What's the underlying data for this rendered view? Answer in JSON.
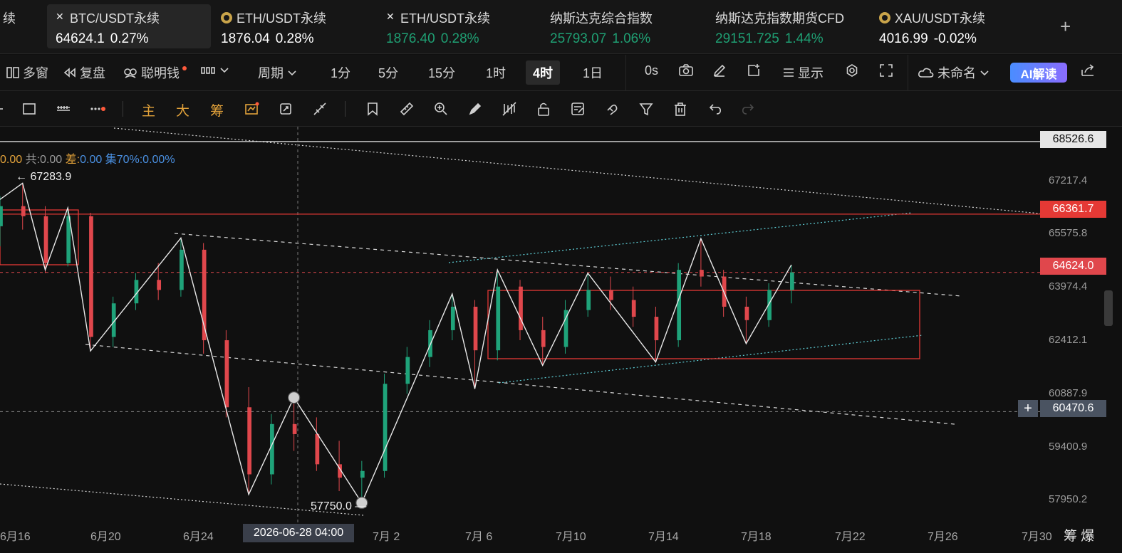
{
  "tickers": [
    {
      "name": "BTC/USDT永续",
      "price": "64624.1",
      "change": "0.27%",
      "icon": "pair-icon",
      "tone": "white",
      "active": true
    },
    {
      "name": "ETH/USDT永续",
      "price": "1876.04",
      "change": "0.28%",
      "icon": "coin-icon",
      "tone": "white"
    },
    {
      "name": "ETH/USDT永续",
      "price": "1876.40",
      "change": "0.28%",
      "icon": "pair-icon",
      "tone": "green"
    },
    {
      "name": "纳斯达克综合指数",
      "price": "25793.07",
      "change": "1.06%",
      "tone": "green"
    },
    {
      "name": "纳斯达克指数期货CFD",
      "price": "29151.725",
      "change": "1.44%",
      "tone": "green"
    },
    {
      "name": "XAU/USDT永续",
      "price": "4016.99",
      "change": "-0.02%",
      "icon": "coin-icon",
      "tone": "white"
    }
  ],
  "ticker_partial": "续",
  "add_tab": "+",
  "toolbar": {
    "multi_window": "多窗",
    "replay": "复盘",
    "smart_money": "聪明钱",
    "period": "周期",
    "intervals": [
      "1分",
      "5分",
      "15分",
      "1时",
      "4时",
      "1日"
    ],
    "selected_interval": "4时",
    "zero_s": "0s",
    "display": "显示",
    "layout_name": "未命名",
    "ai_button": "AI解读"
  },
  "drawbar": {
    "labels": [
      "主",
      "大",
      "筹"
    ]
  },
  "legend": {
    "lead": "0.00",
    "total_label": "共:",
    "total_value": "0.00",
    "diff_label": "差:",
    "diff_value": "0.00",
    "set_label": "集70%:",
    "set_value": "0.00%"
  },
  "price_tags": {
    "top": "68526.6",
    "resistance": "66361.7",
    "current": "64624.0",
    "crosshair": "60470.6"
  },
  "annotations": {
    "high": "67283.9",
    "low": "57750.0"
  },
  "y_axis": [
    "67217.4",
    "65575.8",
    "63974.4",
    "62412.1",
    "60887.9",
    "59400.9",
    "57950.2"
  ],
  "x_axis": [
    "6月16",
    "6月20",
    "6月24",
    "7月 2",
    "7月 6",
    "7月10",
    "7月14",
    "7月18",
    "7月22",
    "7月26",
    "7月30"
  ],
  "crosshair_time": "2026-06-28 04:00",
  "corner_labels": "筹  爆",
  "colors": {
    "up": "#1fa37a",
    "down": "#e0474c",
    "bg": "#101010",
    "accent": "#e53935",
    "current": "#e0474c"
  },
  "chart_data": {
    "type": "candlestick",
    "interval": "4时",
    "ylim": [
      57400,
      68800
    ],
    "x_start": "2026-06-15",
    "x_end": "2026-07-31",
    "price_levels": {
      "top": 68526.6,
      "resistance": 66361.7,
      "current": 64624.0,
      "crosshair": 60470.6
    },
    "zigzag": [
      [
        "2026-06-15",
        66800
      ],
      [
        "2026-06-16",
        67283.9
      ],
      [
        "2026-06-17",
        64700
      ],
      [
        "2026-06-18",
        66550
      ],
      [
        "2026-06-19",
        62280
      ],
      [
        "2026-06-23",
        65650
      ],
      [
        "2026-06-26",
        58000
      ],
      [
        "2026-06-28",
        60890
      ],
      [
        "2026-07-01",
        57750
      ],
      [
        "2026-07-05",
        63980
      ],
      [
        "2026-07-06",
        61150
      ],
      [
        "2026-07-07",
        64700
      ],
      [
        "2026-07-09",
        61850
      ],
      [
        "2026-07-11",
        64600
      ],
      [
        "2026-07-14",
        61950
      ],
      [
        "2026-07-16",
        65630
      ],
      [
        "2026-07-18",
        62500
      ],
      [
        "2026-07-20",
        64850
      ]
    ],
    "candles": [
      [
        "2026-06-15",
        66000,
        66900,
        65400,
        66600
      ],
      [
        "2026-06-16",
        66600,
        67283.9,
        65900,
        66300
      ],
      [
        "2026-06-17",
        66300,
        66600,
        64600,
        64900
      ],
      [
        "2026-06-18",
        64900,
        66550,
        64800,
        66300
      ],
      [
        "2026-06-19",
        66300,
        66400,
        62280,
        62700
      ],
      [
        "2026-06-20",
        62700,
        63900,
        62400,
        63700
      ],
      [
        "2026-06-21",
        63700,
        64600,
        63500,
        64400
      ],
      [
        "2026-06-22",
        64400,
        64900,
        63800,
        64100
      ],
      [
        "2026-06-23",
        64100,
        65650,
        63900,
        65300
      ],
      [
        "2026-06-24",
        65300,
        65500,
        62200,
        62600
      ],
      [
        "2026-06-25",
        62600,
        62900,
        60300,
        60600
      ],
      [
        "2026-06-26",
        60600,
        61200,
        58000,
        58600
      ],
      [
        "2026-06-27",
        58600,
        60400,
        58300,
        60100
      ],
      [
        "2026-06-28",
        60100,
        60890,
        59300,
        59800
      ],
      [
        "2026-06-29",
        59800,
        60300,
        58700,
        58900
      ],
      [
        "2026-06-30",
        58900,
        59600,
        58100,
        58500
      ],
      [
        "2026-07-01",
        58500,
        59000,
        57750,
        58700
      ],
      [
        "2026-07-02",
        58700,
        61600,
        58500,
        61300
      ],
      [
        "2026-07-03",
        61300,
        62400,
        61000,
        62100
      ],
      [
        "2026-07-04",
        62100,
        63200,
        61800,
        62900
      ],
      [
        "2026-07-05",
        62900,
        63980,
        62600,
        63600
      ],
      [
        "2026-07-06",
        63600,
        63800,
        61150,
        62300
      ],
      [
        "2026-07-07",
        62300,
        64700,
        62000,
        64200
      ],
      [
        "2026-07-08",
        64200,
        64400,
        62600,
        62900
      ],
      [
        "2026-07-09",
        62900,
        63300,
        61850,
        62400
      ],
      [
        "2026-07-10",
        62400,
        63800,
        62200,
        63500
      ],
      [
        "2026-07-11",
        63500,
        64600,
        63300,
        64100
      ],
      [
        "2026-07-12",
        64100,
        64500,
        63500,
        63800
      ],
      [
        "2026-07-13",
        63800,
        64200,
        63000,
        63300
      ],
      [
        "2026-07-14",
        63300,
        63600,
        61950,
        62600
      ],
      [
        "2026-07-15",
        62600,
        64900,
        62400,
        64700
      ],
      [
        "2026-07-16",
        64700,
        65630,
        64200,
        64500
      ],
      [
        "2026-07-17",
        64500,
        64700,
        63300,
        63600
      ],
      [
        "2026-07-18",
        63600,
        63900,
        62500,
        63200
      ],
      [
        "2026-07-19",
        63200,
        64300,
        63000,
        64100
      ],
      [
        "2026-07-20",
        64100,
        64850,
        63700,
        64624.0
      ]
    ]
  }
}
